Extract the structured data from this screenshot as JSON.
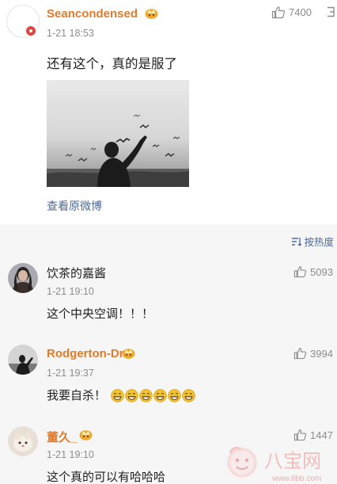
{
  "post": {
    "username": "Seancondensed",
    "timestamp": "1-21 18:53",
    "like_count": "7400",
    "text": "还有这个，真的是服了",
    "origin_link": "查看原微博",
    "badge_color": "#e0463f",
    "username_color": "#e07b2a"
  },
  "sort": {
    "label": "按热度"
  },
  "comments": [
    {
      "username": "饮茶的嘉酱",
      "timestamp": "1-21 19:10",
      "like_count": "5093",
      "text": "这个中央空调！！！"
    },
    {
      "username": "Rodgerton-Dr",
      "timestamp": "1-21 19:37",
      "like_count": "3994",
      "text": "我要自杀！",
      "emoji": [
        "grin-emoji",
        "grin-emoji",
        "grin-emoji",
        "grin-emoji",
        "grin-emoji",
        "grin-emoji"
      ]
    },
    {
      "username": "董久_",
      "timestamp": "1-21 19:10",
      "like_count": "1447",
      "text": "这个真的可以有哈哈哈"
    }
  ],
  "watermark": {
    "logo_text": "八宝网",
    "url": "www.8bb.com"
  },
  "colors": {
    "link": "#4b6a9b",
    "meta": "#8c8c8c",
    "comment_bg": "#f6f6f6"
  }
}
